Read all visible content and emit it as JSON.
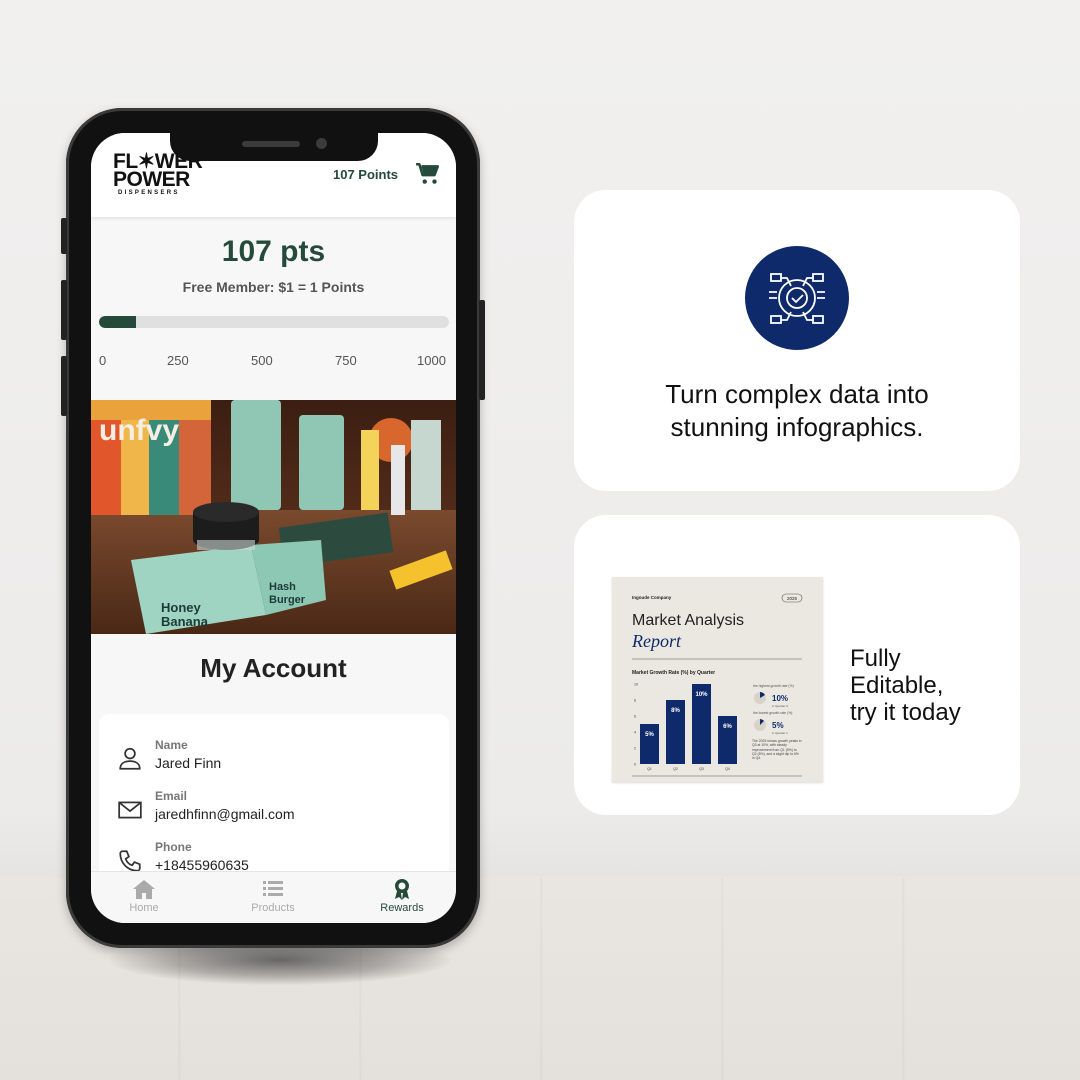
{
  "app": {
    "logo_line1": "FL✶WER",
    "logo_line2": "POWER",
    "logo_line3": "DISPENSERS",
    "header_points": "107 Points",
    "cart_icon": "cart-icon"
  },
  "rewards": {
    "points_display": "107 pts",
    "membership": "Free Member: $1 = 1 Points",
    "progress_fraction": 0.107,
    "scale_ticks": [
      "0",
      "250",
      "500",
      "750",
      "1000"
    ]
  },
  "account": {
    "title": "My Account",
    "fields": [
      {
        "key": "Name",
        "value": "Jared Finn",
        "icon": "person-icon"
      },
      {
        "key": "Email",
        "value": "jaredhfinn@gmail.com",
        "icon": "mail-icon"
      },
      {
        "key": "Phone",
        "value": "+18455960635",
        "icon": "phone-icon"
      }
    ]
  },
  "nav": {
    "items": [
      {
        "label": "Home",
        "icon": "home-icon"
      },
      {
        "label": "Products",
        "icon": "list-icon"
      },
      {
        "label": "Rewards",
        "icon": "award-icon"
      }
    ],
    "active": "Rewards"
  },
  "promo": {
    "card1_text_line1": "Turn complex data into",
    "card1_text_line2": "stunning infographics.",
    "card2_line1": "Fully",
    "card2_line2": "Editable,",
    "card2_line3": "try it today"
  },
  "report_thumb": {
    "company": "Ingoude Company",
    "year": "2025",
    "title1": "Market Analysis",
    "title2": "Report",
    "chart_title": "Market Growth Rate (%) by Quarter",
    "stat1_label": "the highest growth rate (%)",
    "stat1_value": "10%",
    "stat1_sub": "in Quarter 3",
    "stat2_label": "the lowest growth rate (%)",
    "stat2_value": "5%",
    "stat2_sub": "in Quarter 1",
    "note": "The 2025 shows growth peaks in Q3 at 10%, with steady improvement from Q1 (5%) to Q2 (8%), and a slight dip to 6% in Q4."
  },
  "chart_data": {
    "type": "bar",
    "title": "Market Growth Rate (%) by Quarter",
    "categories": [
      "Q1",
      "Q2",
      "Q3",
      "Q4"
    ],
    "values": [
      5,
      8,
      10,
      6
    ],
    "value_labels": [
      "5%",
      "8%",
      "10%",
      "6%"
    ],
    "y_ticks": [
      "0",
      "2",
      "4",
      "6",
      "8",
      "10"
    ],
    "ylim": [
      0,
      10
    ],
    "color": "#0f2a6a"
  },
  "colors": {
    "brand_green": "#254a3b",
    "navy": "#0f2a6a"
  }
}
